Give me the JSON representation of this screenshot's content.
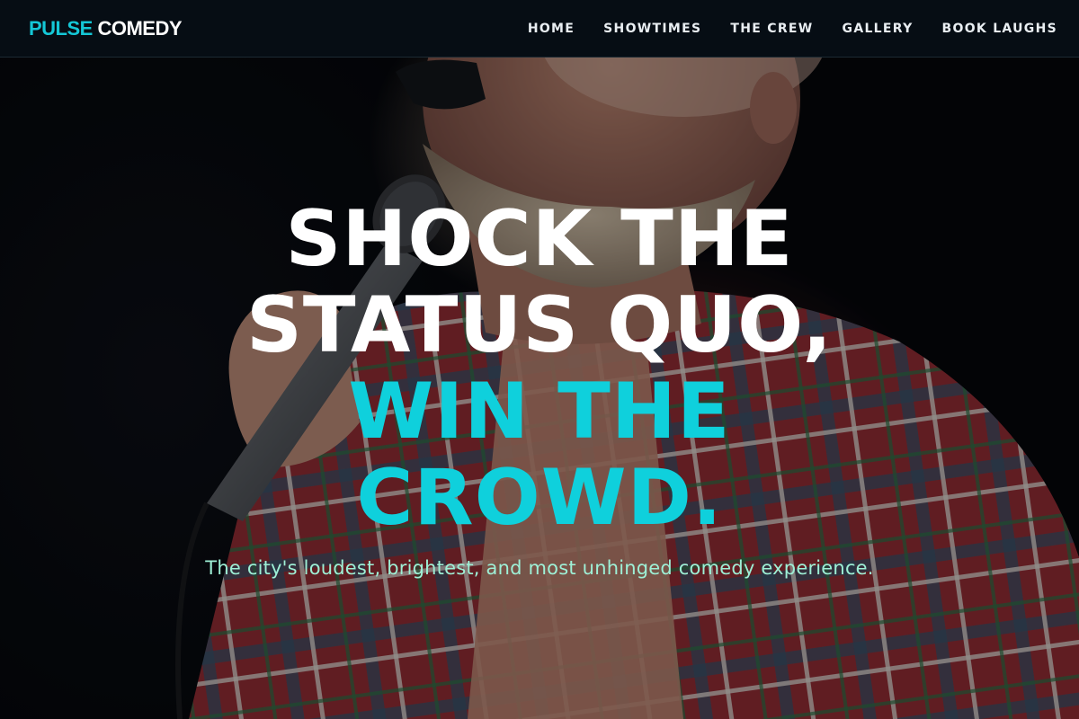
{
  "brand": {
    "part1": "PULSE",
    "part2": "COMEDY"
  },
  "nav": {
    "items": [
      {
        "label": "HOME"
      },
      {
        "label": "SHOWTIMES"
      },
      {
        "label": "THE CREW"
      },
      {
        "label": "GALLERY"
      },
      {
        "label": "BOOK LAUGHS"
      }
    ]
  },
  "hero": {
    "headline_lines": [
      "SHOCK THE",
      "STATUS QUO,",
      "WIN THE",
      "CROWD."
    ],
    "tagline": "The city's loudest, brightest, and most unhinged comedy experience."
  },
  "colors": {
    "accent": "#0fd0dc",
    "tagline": "#9ef0d6",
    "nav_bg": "#060d14"
  }
}
